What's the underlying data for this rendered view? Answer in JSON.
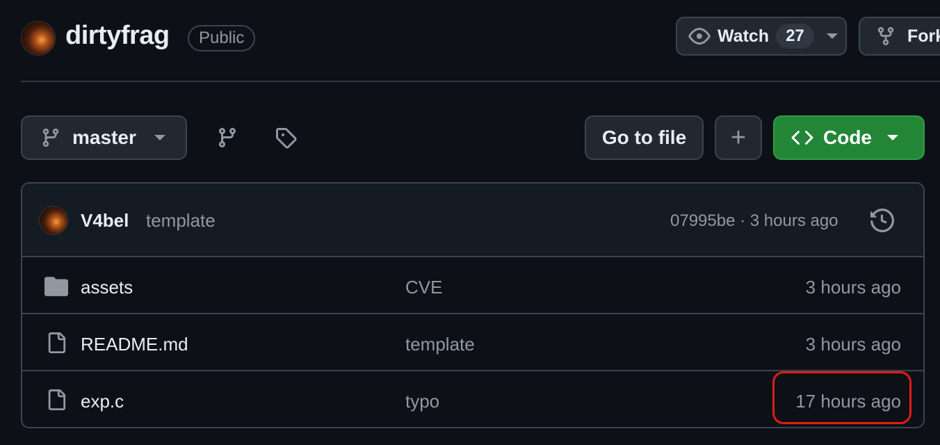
{
  "repo": {
    "name": "dirtyfrag",
    "visibility": "Public"
  },
  "header": {
    "watch_label": "Watch",
    "watch_count": "27",
    "fork_label": "Fork"
  },
  "toolbar": {
    "branch": "master",
    "goto_file_label": "Go to file",
    "add_label": "+",
    "code_label": "Code"
  },
  "latest_commit": {
    "author": "V4bel",
    "message": "template",
    "hash_time": "07995be · 3 hours ago"
  },
  "files": [
    {
      "name": "assets",
      "type": "folder",
      "message": "CVE",
      "time": "3 hours ago"
    },
    {
      "name": "README.md",
      "type": "file",
      "message": "template",
      "time": "3 hours ago"
    },
    {
      "name": "exp.c",
      "type": "file",
      "message": "typo",
      "time": "17 hours ago"
    }
  ],
  "colors": {
    "background": "#0d1117",
    "code_button": "#238636",
    "highlight": "#e11d16"
  }
}
